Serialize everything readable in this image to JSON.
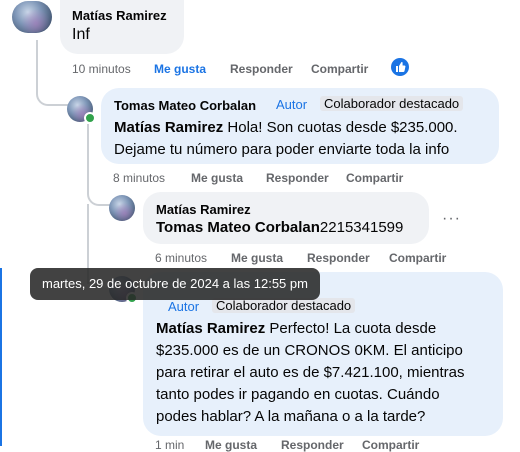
{
  "comments": [
    {
      "author": "Matías Ramirez",
      "text": "Inf",
      "time": "10 minutos",
      "like": "Me gusta",
      "reply": "Responder",
      "share": "Compartir",
      "reaction_icon": "thumbs-up-icon"
    },
    {
      "author": "Tomas Mateo Corbalan",
      "role": "Autor",
      "badge": "Colaborador destacado",
      "mention": "Matías Ramirez",
      "text_line1": "Hola! Son cuotas desde $235.000.",
      "text_line2": "Dejame tu número para poder enviarte toda la info",
      "time": "8 minutos",
      "like": "Me gusta",
      "reply": "Responder",
      "share": "Compartir"
    },
    {
      "author": "Matías Ramirez",
      "mention": "Tomas Mateo Corbalan",
      "text": "2215341599",
      "time": "6 minutos",
      "like": "Me gusta",
      "reply": "Responder",
      "share": "Compartir",
      "more": "···"
    },
    {
      "role": "Autor",
      "badge": "Colaborador destacado",
      "mention": "Matías Ramirez",
      "line1": "Perfecto! La cuota desde",
      "line2": "$235.000 es de un CRONOS 0KM. El anticipo",
      "line3": "para retirar el auto es de $7.421.100, mientras",
      "line4": "tanto podes ir pagando en cuotas. Cuándo",
      "line5": "podes hablar? A la mañana o a la tarde?",
      "time": "1 min",
      "like": "Me gusta",
      "reply": "Responder",
      "share": "Compartir"
    }
  ],
  "tooltip": "martes, 29 de octubre de 2024 a las 12:55 pm",
  "colors": {
    "link": "#1b74e4",
    "meta": "#65676b",
    "bubble": "#f0f2f5",
    "online": "#31a24c"
  }
}
